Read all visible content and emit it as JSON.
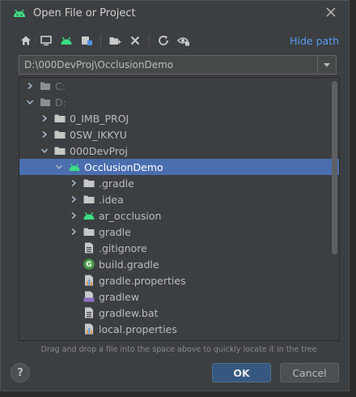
{
  "dialog": {
    "title": "Open File or Project",
    "hide_path_label": "Hide path",
    "path_value": "D:\\000DevProj\\OcclusionDemo",
    "hint": "Drag and drop a file into the space above to quickly locate it in the tree",
    "ok_label": "OK",
    "cancel_label": "Cancel",
    "help_label": "?"
  },
  "toolbar": [
    {
      "name": "home-icon"
    },
    {
      "name": "desktop-icon"
    },
    {
      "name": "android-project-icon"
    },
    {
      "name": "module-icon"
    },
    {
      "name": "new-folder-icon"
    },
    {
      "name": "delete-icon"
    },
    {
      "name": "refresh-icon"
    },
    {
      "name": "show-hidden-files-icon"
    }
  ],
  "tree": [
    {
      "label": "C:",
      "depth": 0,
      "arrow": "collapsed",
      "icon": "drive",
      "dim": true
    },
    {
      "label": "D:",
      "depth": 0,
      "arrow": "expanded",
      "icon": "drive",
      "dim": true
    },
    {
      "label": "0_IMB_PROJ",
      "depth": 1,
      "arrow": "collapsed",
      "icon": "folder"
    },
    {
      "label": "0SW_IKKYU",
      "depth": 1,
      "arrow": "collapsed",
      "icon": "folder"
    },
    {
      "label": "000DevProj",
      "depth": 1,
      "arrow": "expanded",
      "icon": "folder"
    },
    {
      "label": "OcclusionDemo",
      "depth": 2,
      "arrow": "expanded",
      "icon": "android",
      "selected": true
    },
    {
      "label": ".gradle",
      "depth": 3,
      "arrow": "collapsed",
      "icon": "folder"
    },
    {
      "label": ".idea",
      "depth": 3,
      "arrow": "collapsed",
      "icon": "folder"
    },
    {
      "label": "ar_occlusion",
      "depth": 3,
      "arrow": "collapsed",
      "icon": "android"
    },
    {
      "label": "gradle",
      "depth": 3,
      "arrow": "collapsed",
      "icon": "folder"
    },
    {
      "label": ".gitignore",
      "depth": 3,
      "arrow": "none",
      "icon": "file"
    },
    {
      "label": "build.gradle",
      "depth": 3,
      "arrow": "none",
      "icon": "gradle"
    },
    {
      "label": "gradle.properties",
      "depth": 3,
      "arrow": "none",
      "icon": "properties"
    },
    {
      "label": "gradlew",
      "depth": 3,
      "arrow": "none",
      "icon": "script"
    },
    {
      "label": "gradlew.bat",
      "depth": 3,
      "arrow": "none",
      "icon": "file"
    },
    {
      "label": "local.properties",
      "depth": 3,
      "arrow": "none",
      "icon": "properties"
    }
  ],
  "colors": {
    "accent_link": "#589df6",
    "selection": "#4b6eaf",
    "android_green": "#3ddc84",
    "folder": "#c5c8c6"
  }
}
